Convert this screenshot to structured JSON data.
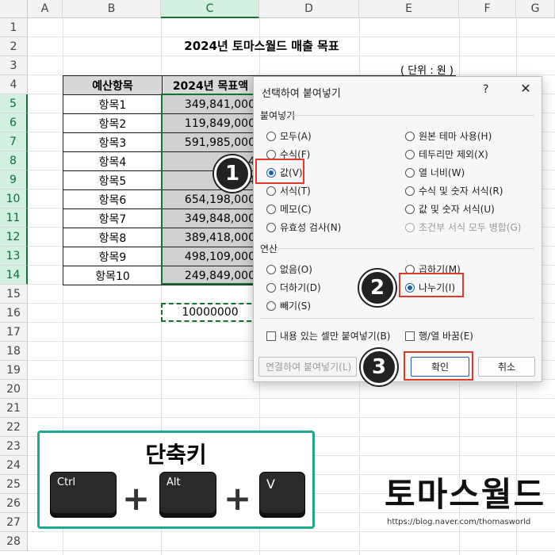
{
  "columns": [
    "A",
    "B",
    "C",
    "D",
    "E",
    "F",
    "G"
  ],
  "rows": [
    "1",
    "2",
    "3",
    "4",
    "5",
    "6",
    "7",
    "8",
    "9",
    "10",
    "11",
    "12",
    "13",
    "14",
    "15",
    "16",
    "17",
    "18",
    "19",
    "20",
    "21",
    "22",
    "23",
    "24",
    "25",
    "26",
    "27",
    "28"
  ],
  "sheet": {
    "title": "2024년 토마스월드 매출 목표",
    "unit": "( 단위 : 원 )",
    "header_item": "예산항목",
    "header_amount": "2024년 목표액",
    "items": [
      {
        "name": "항목1",
        "amount": "349,841,000"
      },
      {
        "name": "항목2",
        "amount": "119,849,000"
      },
      {
        "name": "항목3",
        "amount": "591,985,000"
      },
      {
        "name": "항목4",
        "amount": "398,4"
      },
      {
        "name": "항목5",
        "amount": "898,4"
      },
      {
        "name": "항목6",
        "amount": "654,198,000"
      },
      {
        "name": "항목7",
        "amount": "349,848,000"
      },
      {
        "name": "항목8",
        "amount": "389,418,000"
      },
      {
        "name": "항목9",
        "amount": "498,109,000"
      },
      {
        "name": "항목10",
        "amount": "249,849,000"
      }
    ],
    "copy_value": "10000000"
  },
  "dialog": {
    "title": "선택하여 붙여넣기",
    "help": "?",
    "close": "✕",
    "paste_group": "붙여넣기",
    "paste_left": [
      "모두(A)",
      "수식(F)",
      "값(V)",
      "서식(T)",
      "메모(C)",
      "유효성 검사(N)"
    ],
    "paste_right": [
      "원본 테마 사용(H)",
      "테두리만 제외(X)",
      "열 너비(W)",
      "수식 및 숫자 서식(R)",
      "값 및 숫자 서식(U)",
      "조건부 서식 모두 병합(G)"
    ],
    "op_group": "연산",
    "op_left": [
      "없음(O)",
      "더하기(D)",
      "빼기(S)"
    ],
    "op_right": [
      "곱하기(M)",
      "나누기(I)"
    ],
    "skip_blanks": "내용 있는 셀만 붙여넣기(B)",
    "transpose": "행/열 바꿈(E)",
    "paste_link": "연결하여 붙여넣기(L)",
    "ok": "확인",
    "cancel": "취소"
  },
  "badges": [
    "1",
    "2",
    "3"
  ],
  "shortcut": {
    "title": "단축키",
    "keys": [
      "Ctrl",
      "Alt",
      "V"
    ],
    "plus": "+"
  },
  "brand": {
    "logo": "토마스월드",
    "url": "https://blog.naver.com/thomasworld"
  },
  "colors": {
    "excel_green": "#137333",
    "highlight_red": "#e0392c",
    "frame_teal": "#1fa88b"
  }
}
